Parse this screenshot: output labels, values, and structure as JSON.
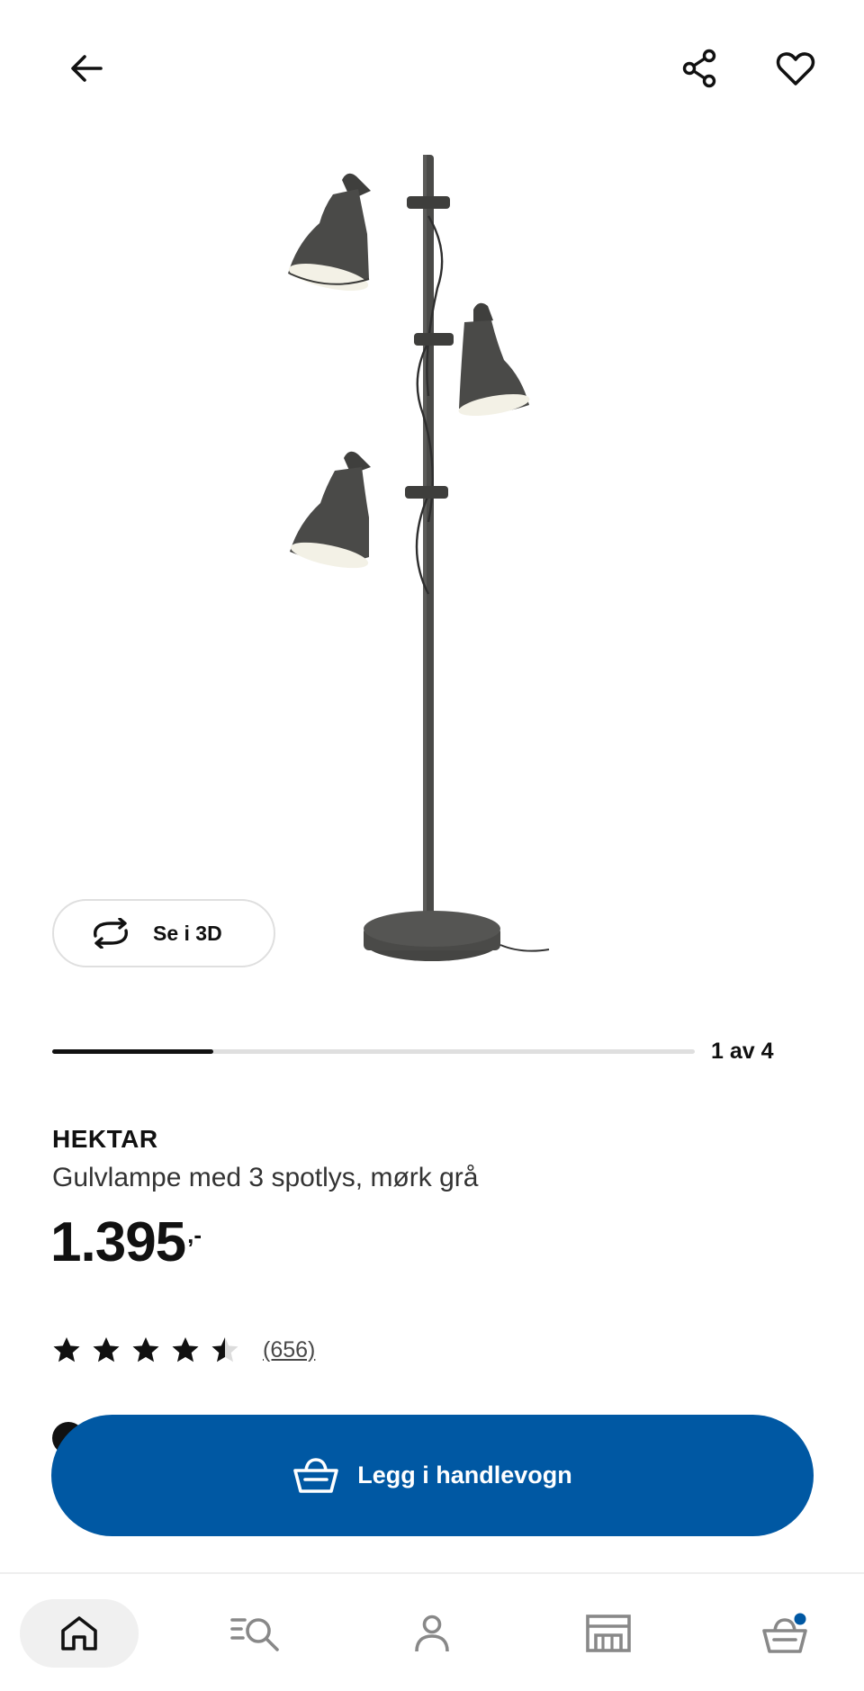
{
  "header": {
    "back_icon": "arrow-left-icon",
    "share_icon": "share-icon",
    "favorite_icon": "heart-icon"
  },
  "gallery": {
    "view_3d_label": "Se i 3D",
    "view_3d_icon": "rotate-3d-icon",
    "counter_text": "1 av 4",
    "current_index": 1,
    "total": 4
  },
  "product": {
    "name": "HEKTAR",
    "description": "Gulvlampe med 3 spotlys, mørk grå",
    "price_main": "1.395",
    "price_suffix": ",-",
    "rating_value": 4.5,
    "rating_max": 5,
    "review_count": "(656)"
  },
  "actions": {
    "add_to_cart_label": "Legg i handlevogn",
    "add_to_cart_icon": "basket-icon"
  },
  "nav": {
    "items": [
      {
        "name": "home",
        "icon": "home-icon",
        "active": true
      },
      {
        "name": "search",
        "icon": "search-list-icon",
        "active": false
      },
      {
        "name": "profile",
        "icon": "person-icon",
        "active": false
      },
      {
        "name": "store",
        "icon": "store-icon",
        "active": false
      },
      {
        "name": "cart",
        "icon": "cart-icon",
        "active": false,
        "badge": true
      }
    ]
  },
  "colors": {
    "primary": "#0058a3",
    "text": "#111111",
    "badge": "#0058a3",
    "lamp": "#4a4a48"
  }
}
